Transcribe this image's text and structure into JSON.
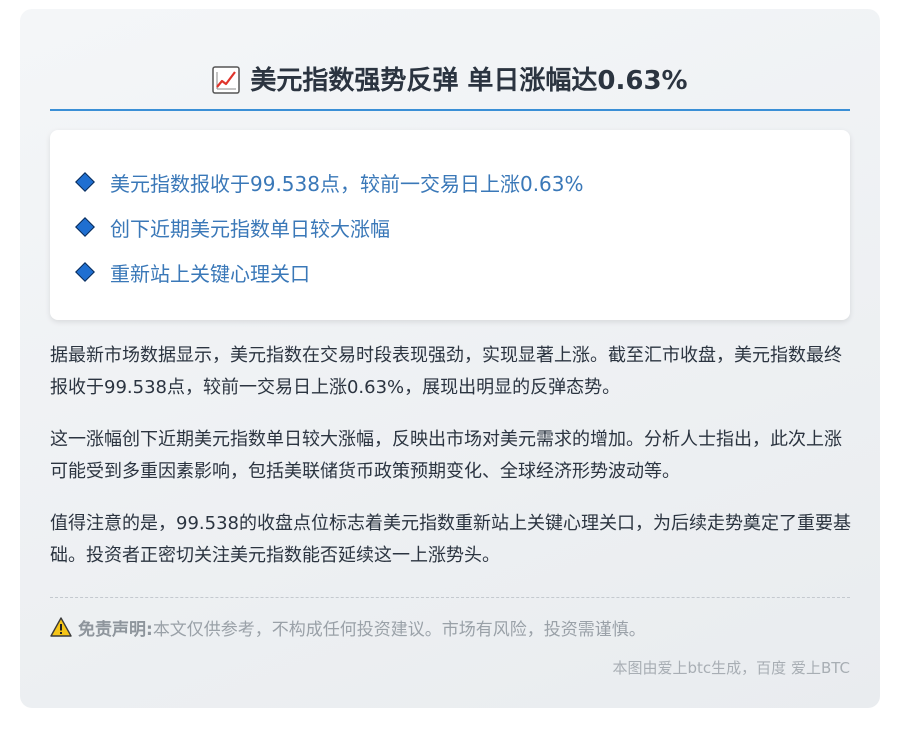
{
  "article": {
    "title_icon": "chart-increasing-icon",
    "title": "美元指数强势反弹 单日涨幅达0.63%",
    "key_points": [
      "美元指数报收于99.538点，较前一交易日上涨0.63%",
      "创下近期美元指数单日较大涨幅",
      "重新站上关键心理关口"
    ],
    "paragraphs": [
      "据最新市场数据显示，美元指数在交易时段表现强劲，实现显著上涨。截至汇市收盘，美元指数最终报收于99.538点，较前一交易日上涨0.63%，展现出明显的反弹态势。",
      "这一涨幅创下近期美元指数单日较大涨幅，反映出市场对美元需求的增加。分析人士指出，此次上涨可能受到多重因素影响，包括美联储货币政策预期变化、全球经济形势波动等。",
      "值得注意的是，99.538的收盘点位标志着美元指数重新站上关键心理关口，为后续走势奠定了重要基础。投资者正密切关注美元指数能否延续这一上涨势头。"
    ],
    "disclaimer": {
      "icon": "warning-icon",
      "label": "免责声明:",
      "text": "本文仅供参考，不构成任何投资建议。市场有风险，投资需谨慎。"
    },
    "footer": "本图由爱上btc生成，百度 爱上BTC"
  },
  "colors": {
    "accent": "#3a8fd6",
    "point_text": "#3a78b8",
    "diamond": "#1f6fd1",
    "body_text": "#2b3440",
    "muted": "#9aa1a8"
  }
}
